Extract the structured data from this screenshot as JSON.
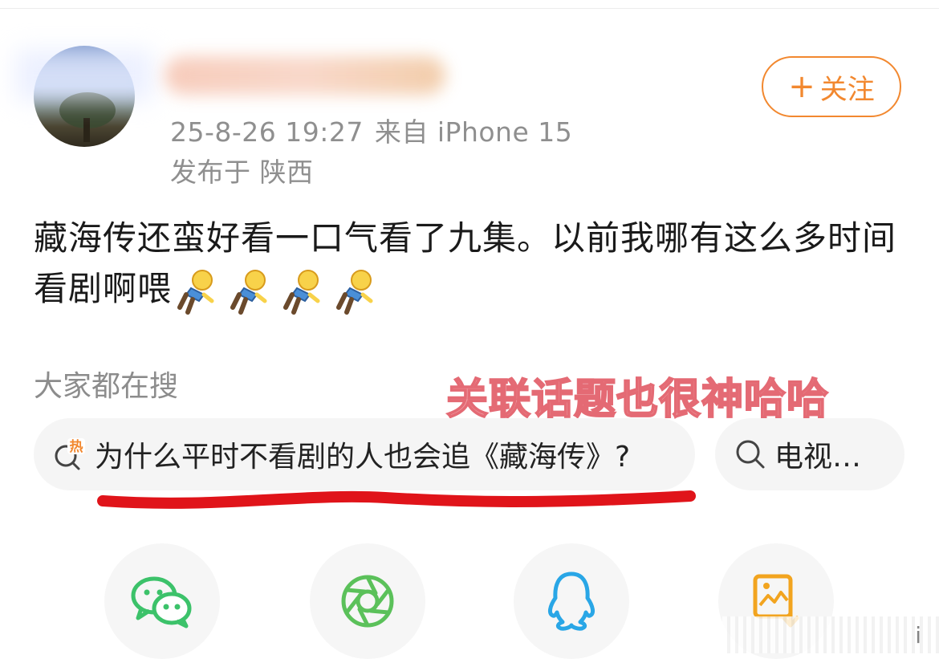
{
  "post": {
    "timestamp": "25-8-26 19:27",
    "source": "来自 iPhone 15",
    "location": "发布于 陕西",
    "text": "藏海传还蛮好看一口气看了九集。以前我哪有这么多时间看剧啊喂",
    "emoji_count": 4
  },
  "follow_button": {
    "plus": "+",
    "label": "关注"
  },
  "search": {
    "heading": "大家都在搜",
    "chips": [
      {
        "label": "为什么平时不看剧的人也会追《藏海传》?",
        "badge": "热"
      },
      {
        "label": "电视…"
      }
    ]
  },
  "annotation": "关联话题也很神哈哈",
  "share_icons": [
    "wechat-icon",
    "moments-icon",
    "qq-icon",
    "save-image-icon"
  ],
  "colors": {
    "accent": "#f2882f",
    "wechat": "#3cc26a",
    "moments": "#5bc15a",
    "qq": "#29a6e6",
    "save": "#f2a41f",
    "annotation": "#e46a74"
  }
}
